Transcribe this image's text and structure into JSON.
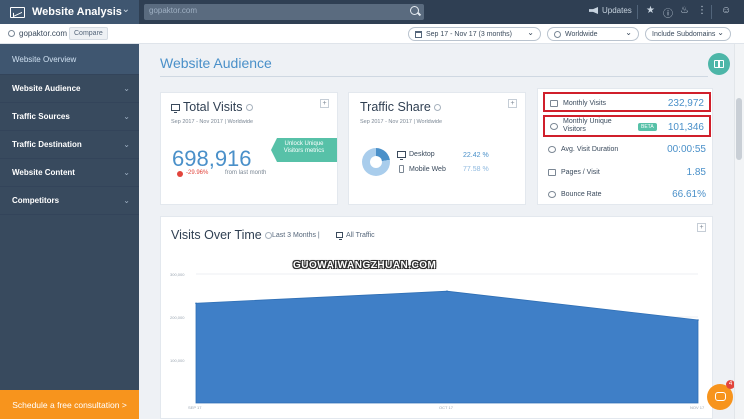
{
  "topbar": {
    "app_title": "Website Analysis",
    "search_value": "gopaktor.com",
    "updates_label": "Updates"
  },
  "subbar": {
    "domain": "gopaktor.com",
    "compare_label": "Compare",
    "date_range": "Sep 17 - Nov 17 (3 months)",
    "country": "Worldwide",
    "subdomains": "Include Subdomains"
  },
  "sidebar": {
    "items": [
      {
        "label": "Website Overview"
      },
      {
        "label": "Website Audience"
      },
      {
        "label": "Traffic Sources"
      },
      {
        "label": "Traffic Destination"
      },
      {
        "label": "Website Content"
      },
      {
        "label": "Competitors"
      }
    ],
    "cta": "Schedule a free consultation >"
  },
  "main": {
    "page_title": "Website Audience",
    "total_visits": {
      "title": "Total Visits",
      "subtitle": "Sep 2017 - Nov 2017 | Worldwide",
      "value": "698,916",
      "change": "-29.96%",
      "change_suffix": "from last month",
      "unlock_line1": "Unlock Unique",
      "unlock_line2": "Visitors metrics"
    },
    "traffic_share": {
      "title": "Traffic Share",
      "subtitle": "Sep 2017 - Nov 2017 | Worldwide",
      "desktop_label": "Desktop",
      "desktop_pct": "22.42 %",
      "mobile_label": "Mobile Web",
      "mobile_pct": "77.58 %",
      "desktop_share": 22.42
    },
    "metrics": [
      {
        "label": "Monthly Visits",
        "value": "232,972"
      },
      {
        "label": "Monthly Unique Visitors",
        "value": "101,346",
        "badge": "BETA"
      },
      {
        "label": "Avg. Visit Duration",
        "value": "00:00:55"
      },
      {
        "label": "Pages / Visit",
        "value": "1.85"
      },
      {
        "label": "Bounce Rate",
        "value": "66.61%"
      }
    ],
    "chart_card": {
      "title": "Visits Over Time",
      "range": "Last 3 Months |",
      "source": "All Traffic"
    }
  },
  "chart_data": {
    "type": "area",
    "x": [
      "SEP 17",
      "OCT 17",
      "NOV 17"
    ],
    "values": [
      232000,
      260000,
      193000
    ],
    "y_ticks": [
      "300,000",
      "200,000",
      "100,000"
    ],
    "ylim": [
      0,
      300000
    ],
    "color": "#3f7fc7",
    "grid": true
  },
  "watermark": "GUOWAIWANGZHUAN.COM",
  "chat_badge": "4",
  "colors": {
    "accent": "#4a90c9",
    "sidebar": "#384a5e",
    "cta": "#f7941d",
    "highlight": "#d01f2b",
    "unlock": "#57c1a8"
  }
}
